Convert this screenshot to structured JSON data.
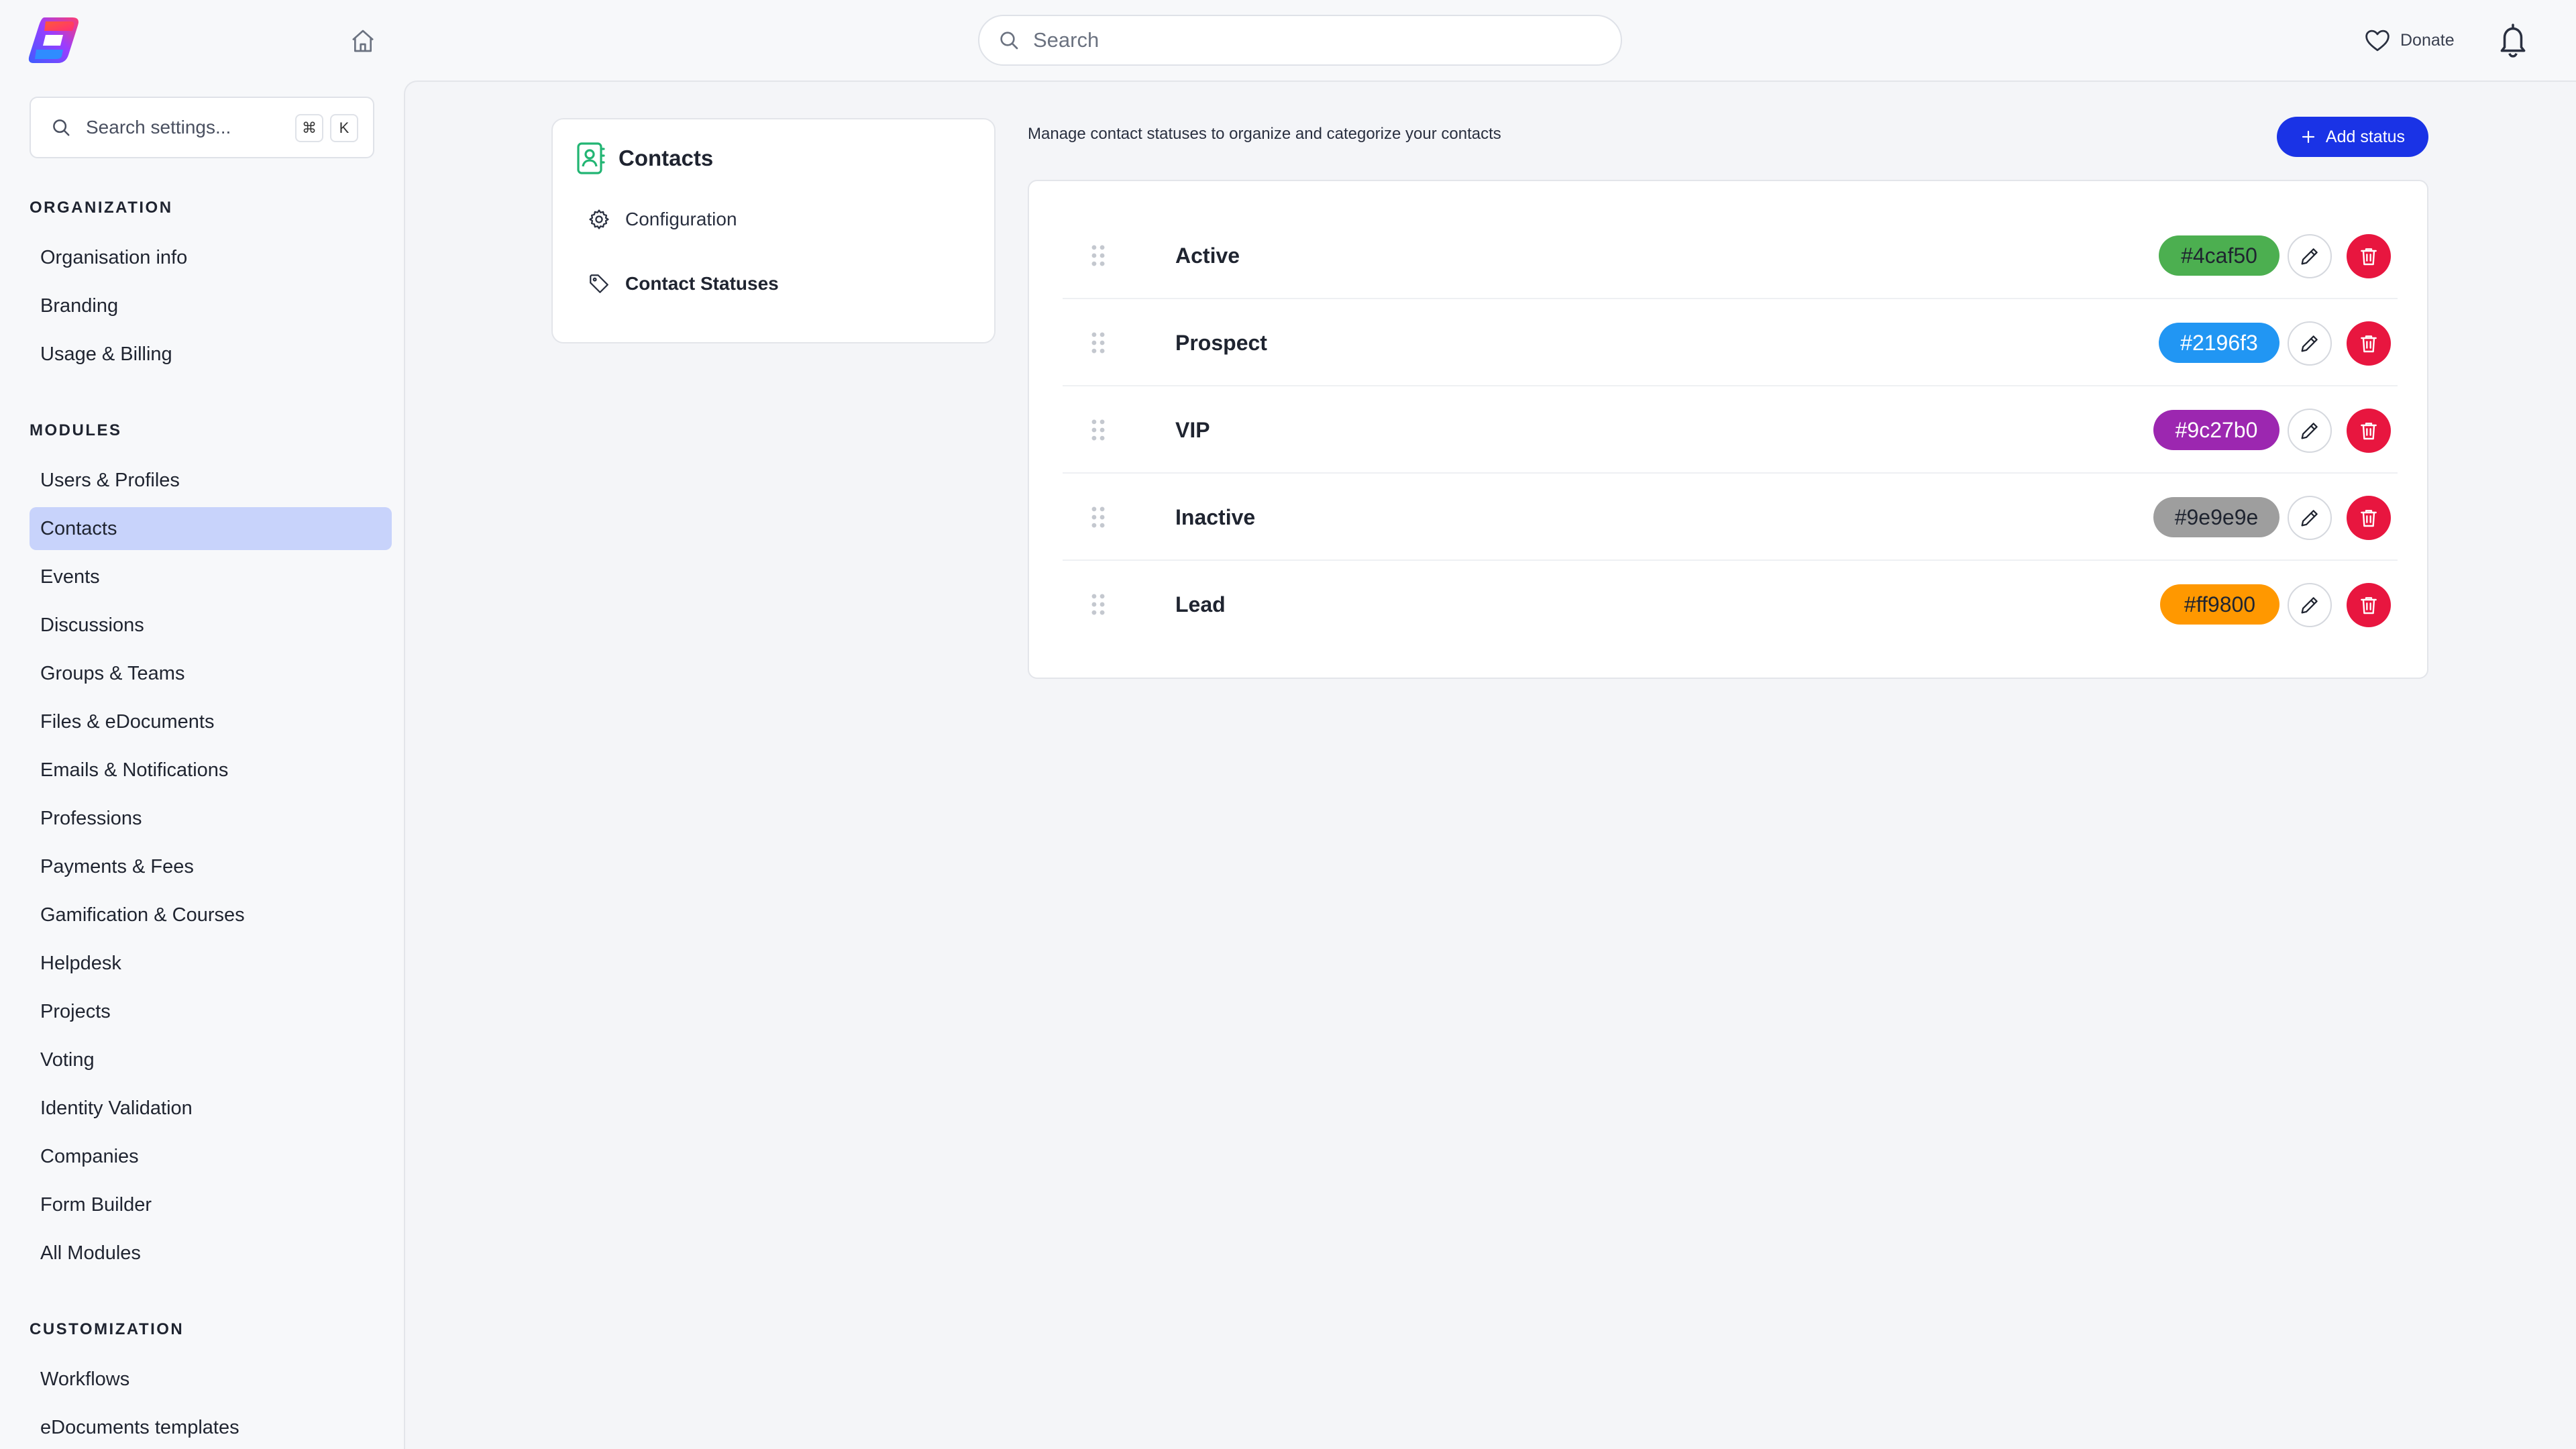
{
  "header": {
    "search_placeholder": "Search",
    "donate_label": "Donate"
  },
  "sidebar": {
    "search_placeholder": "Search settings...",
    "shortcut_keys": [
      "⌘",
      "K"
    ],
    "sections": [
      {
        "title": "ORGANIZATION",
        "items": [
          "Organisation info",
          "Branding",
          "Usage & Billing"
        ]
      },
      {
        "title": "MODULES",
        "items": [
          "Users & Profiles",
          "Contacts",
          "Events",
          "Discussions",
          "Groups & Teams",
          "Files & eDocuments",
          "Emails & Notifications",
          "Professions",
          "Payments & Fees",
          "Gamification & Courses",
          "Helpdesk",
          "Projects",
          "Voting",
          "Identity Validation",
          "Companies",
          "Form Builder",
          "All Modules"
        ]
      },
      {
        "title": "CUSTOMIZATION",
        "items": [
          "Workflows",
          "eDocuments templates"
        ]
      }
    ],
    "active_item": "Contacts"
  },
  "subnav": {
    "title": "Contacts",
    "items": [
      {
        "label": "Configuration",
        "icon": "gear-icon",
        "active": false
      },
      {
        "label": "Contact Statuses",
        "icon": "tag-icon",
        "active": true
      }
    ]
  },
  "main": {
    "description": "Manage contact statuses to organize and categorize your contacts",
    "add_button_label": "Add status",
    "statuses": [
      {
        "name": "Active",
        "color": "#4caf50"
      },
      {
        "name": "Prospect",
        "color": "#2196f3"
      },
      {
        "name": "VIP",
        "color": "#9c27b0"
      },
      {
        "name": "Inactive",
        "color": "#9e9e9e"
      },
      {
        "name": "Lead",
        "color": "#ff9800"
      }
    ]
  },
  "colors": {
    "accent": "#1a33e6",
    "active_nav": "#c8d3fb",
    "delete": "#e8163f",
    "contacts_icon": "#22b573"
  }
}
